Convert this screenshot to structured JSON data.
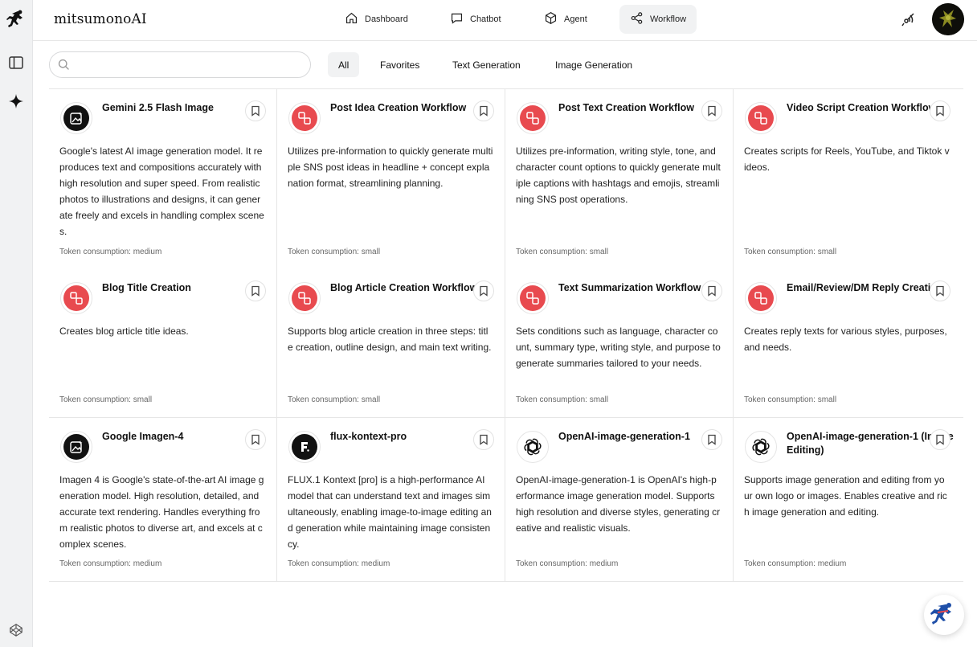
{
  "app": {
    "brand": "mitsumonoAI"
  },
  "nav": [
    {
      "label": "Dashboard",
      "icon": "home-icon"
    },
    {
      "label": "Chatbot",
      "icon": "chat-icon"
    },
    {
      "label": "Agent",
      "icon": "cube-icon"
    },
    {
      "label": "Workflow",
      "icon": "share-nodes-icon",
      "active": true
    }
  ],
  "search": {
    "placeholder": "",
    "value": ""
  },
  "filters": [
    {
      "label": "All",
      "active": true
    },
    {
      "label": "Favorites"
    },
    {
      "label": "Text Generation"
    },
    {
      "label": "Image Generation"
    }
  ],
  "colors": {
    "accent_red": "#e84a4f",
    "dark": "#111111",
    "sidebar_bg": "#f1f2f3"
  },
  "cards": [
    {
      "title": "Gemini 2.5 Flash Image",
      "icon": "image-sparkle-icon",
      "desc": "Google's latest AI image generation model. It reproduces text and compositions accurately with high resolution and super speed. From realistic photos to illustrations and designs, it can generate freely and excels in handling complex scenes.",
      "token": "Token consumption: medium"
    },
    {
      "title": "Post Idea Creation Workflow",
      "icon": "workflow-icon",
      "desc": "Utilizes pre-information to quickly generate multiple SNS post ideas in headline + concept explanation format, streamlining planning.",
      "token": "Token consumption: small"
    },
    {
      "title": "Post Text Creation Workflow",
      "icon": "workflow-icon",
      "desc": "Utilizes pre-information, writing style, tone, and character count options to quickly generate multiple captions with hashtags and emojis, streamlining SNS post operations.",
      "token": "Token consumption: small"
    },
    {
      "title": "Video Script Creation Workflow",
      "icon": "workflow-icon",
      "desc": "Creates scripts for Reels, YouTube, and Tiktok videos.",
      "token": "Token consumption: small"
    },
    {
      "title": "Blog Title Creation",
      "icon": "workflow-icon",
      "desc": "Creates blog article title ideas.",
      "token": "Token consumption: small"
    },
    {
      "title": "Blog Article Creation Workflow",
      "icon": "workflow-icon",
      "desc": "Supports blog article creation in three steps: title creation, outline design, and main text writing.",
      "token": "Token consumption: small"
    },
    {
      "title": "Text Summarization Workflow",
      "icon": "workflow-icon",
      "desc": "Sets conditions such as language, character count, summary type, writing style, and purpose to generate summaries tailored to your needs.",
      "token": "Token consumption: small"
    },
    {
      "title": "Email/Review/DM Reply Creation",
      "icon": "workflow-icon",
      "desc": "Creates reply texts for various styles, purposes, and needs.",
      "token": "Token consumption: small"
    },
    {
      "title": "Google Imagen-4",
      "icon": "image-sparkle-icon",
      "desc": "Imagen 4 is Google's state-of-the-art AI image generation model. High resolution, detailed, and accurate text rendering. Handles everything from realistic photos to diverse art, and excels at complex scenes.",
      "token": "Token consumption: medium"
    },
    {
      "title": "flux-kontext-pro",
      "icon": "flux-logo-icon",
      "desc": "FLUX.1 Kontext [pro] is a high-performance AI model that can understand text and images simultaneously, enabling image-to-image editing and generation while maintaining image consistency.",
      "token": "Token consumption: medium"
    },
    {
      "title": "OpenAI-image-generation-1",
      "icon": "openai-logo-icon",
      "desc": "OpenAI-image-generation-1 is OpenAI's high-performance image generation model. Supports high resolution and diverse styles, generating creative and realistic visuals.",
      "token": "Token consumption: medium"
    },
    {
      "title": "OpenAI-image-generation-1 (Image Editing)",
      "icon": "openai-logo-icon",
      "desc": "Supports image generation and editing from your own logo or images. Enables creative and rich image generation and editing.",
      "token": "Token consumption: medium"
    }
  ]
}
